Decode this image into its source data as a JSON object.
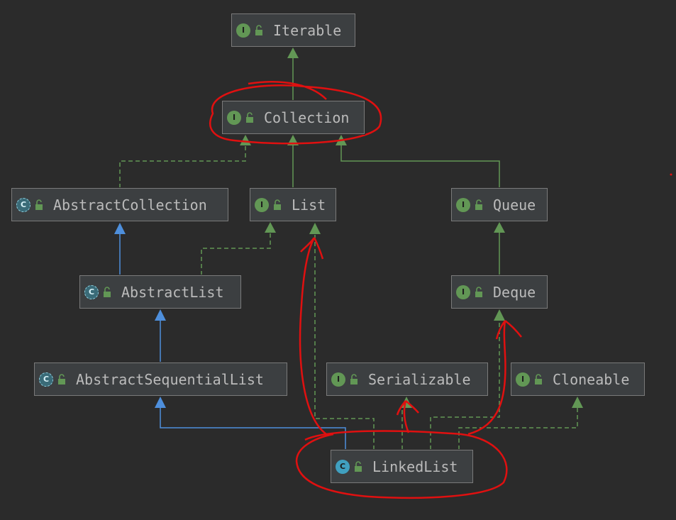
{
  "nodes": {
    "iterable": {
      "label": "Iterable",
      "kind": "I"
    },
    "collection": {
      "label": "Collection",
      "kind": "I"
    },
    "abstract_collection": {
      "label": "AbstractCollection",
      "kind": "C"
    },
    "list": {
      "label": "List",
      "kind": "I"
    },
    "queue": {
      "label": "Queue",
      "kind": "I"
    },
    "abstract_list": {
      "label": "AbstractList",
      "kind": "C"
    },
    "deque": {
      "label": "Deque",
      "kind": "I"
    },
    "abstract_sequential_list": {
      "label": "AbstractSequentialList",
      "kind": "C"
    },
    "serializable": {
      "label": "Serializable",
      "kind": "I"
    },
    "cloneable": {
      "label": "Cloneable",
      "kind": "I"
    },
    "linked_list": {
      "label": "LinkedList",
      "kind": "C"
    }
  },
  "colors": {
    "background": "#2b2b2b",
    "node_fill": "#3c3f41",
    "interface_badge": "#629755",
    "class_badge": "#40a0c0",
    "interface_edge": "#629755",
    "class_edge": "#4e8fdc",
    "annotation": "#e01010"
  }
}
